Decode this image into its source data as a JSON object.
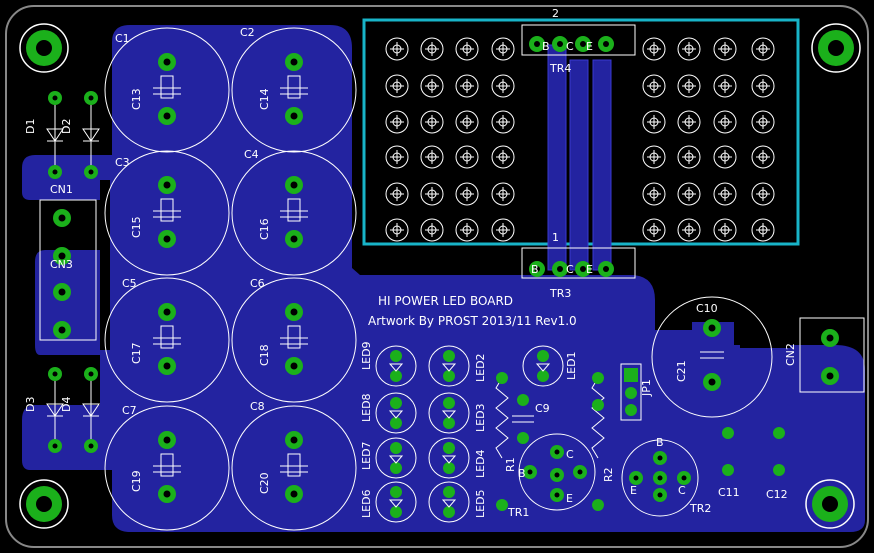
{
  "board": {
    "title": "HI POWER LED BOARD",
    "artwork": "Artwork By PROST 2013/11 Rev1.0"
  },
  "colors": {
    "background": "#000000",
    "copper": "#2323A0",
    "copper_edge": "#3a3ad0",
    "pad": "#1BB01B",
    "outline": "#18B4C8",
    "silk": "#FFFFFF"
  },
  "caps": [
    {
      "id": "C13",
      "ref": "C1"
    },
    {
      "id": "C14",
      "ref": "C2"
    },
    {
      "id": "C15",
      "ref": "C3"
    },
    {
      "id": "C16",
      "ref": "C4"
    },
    {
      "id": "C17",
      "ref": "C5"
    },
    {
      "id": "C18",
      "ref": "C6"
    },
    {
      "id": "C19",
      "ref": "C7"
    },
    {
      "id": "C20",
      "ref": "C8"
    }
  ],
  "diodes": [
    "D1",
    "D2",
    "D3",
    "D4"
  ],
  "connectors": [
    "CN1",
    "CN3",
    "CN2"
  ],
  "leds": [
    "LED9",
    "LED2",
    "LED8",
    "LED3",
    "LED7",
    "LED4",
    "LED6",
    "LED5",
    "LED1"
  ],
  "transistors": [
    "TR4",
    "TR3",
    "TR1",
    "TR2"
  ],
  "pins": {
    "b": "B",
    "c": "C",
    "e": "E"
  },
  "misc": {
    "c9": "C9",
    "c10": "C10",
    "c21": "C21",
    "c11": "C11",
    "c12": "C12",
    "r1": "R1",
    "r2": "R2",
    "jp1": "JP1",
    "n1": "1",
    "n2": "2"
  }
}
